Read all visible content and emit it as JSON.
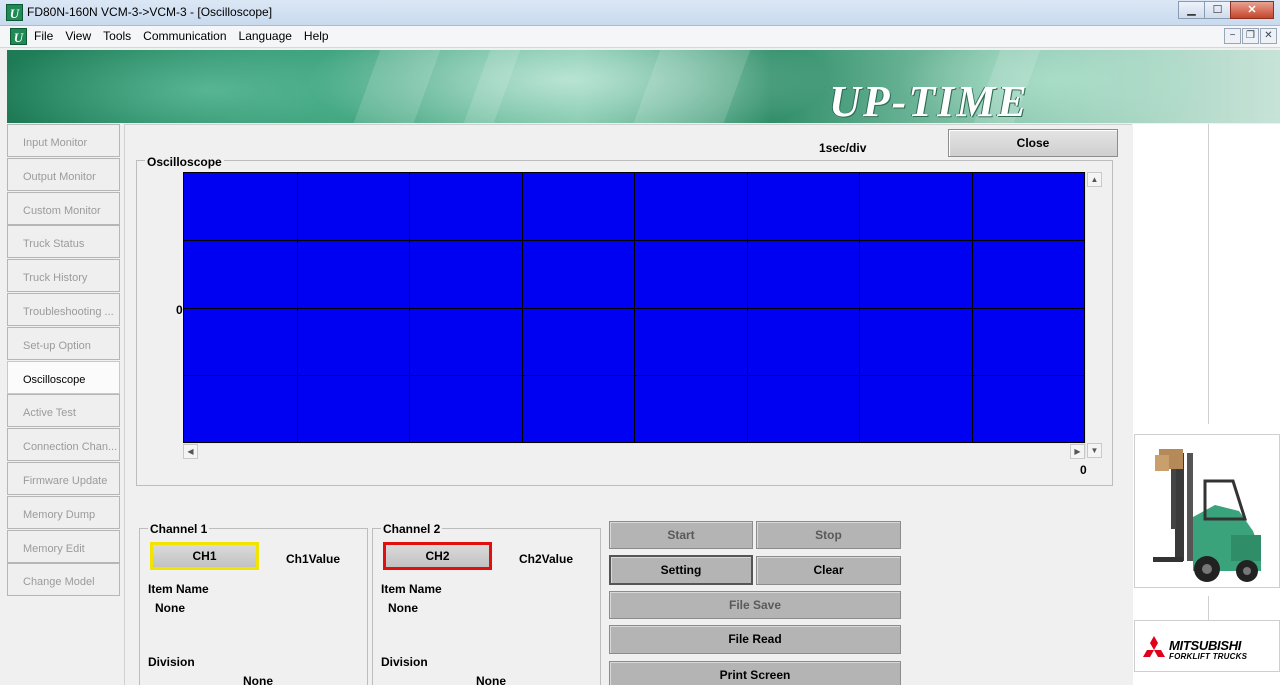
{
  "window": {
    "title": "FD80N-160N VCM-3->VCM-3 - [Oscilloscope]",
    "minimize": "▁",
    "maximize": "☐",
    "close": "✕"
  },
  "menu": {
    "items": [
      "File",
      "View",
      "Tools",
      "Communication",
      "Language",
      "Help"
    ],
    "mdi_minimize": "−",
    "mdi_restore": "❐",
    "mdi_close": "✕"
  },
  "banner": {
    "logo": "UP-TIME"
  },
  "sidebar": {
    "items": [
      {
        "label": "Input Monitor",
        "active": false
      },
      {
        "label": "Output Monitor",
        "active": false
      },
      {
        "label": "Custom Monitor",
        "active": false
      },
      {
        "label": "Truck Status",
        "active": false
      },
      {
        "label": "Truck History",
        "active": false
      },
      {
        "label": "Troubleshooting ...",
        "active": false
      },
      {
        "label": "Set-up Option",
        "active": false
      },
      {
        "label": "Oscilloscope",
        "active": true
      },
      {
        "label": "Active Test",
        "active": false
      },
      {
        "label": "Connection Chan...",
        "active": false
      },
      {
        "label": "Firmware Update",
        "active": false
      },
      {
        "label": "Memory Dump",
        "active": false
      },
      {
        "label": "Memory Edit",
        "active": false
      },
      {
        "label": "Change Model",
        "active": false
      }
    ]
  },
  "oscilloscope": {
    "scale": "1sec/div",
    "close_label": "Close",
    "group_label": "Oscilloscope",
    "y_zero": "0",
    "x_zero": "0",
    "plot_color": "#0000f2",
    "grid_color": "#000000",
    "grid_columns": 8,
    "grid_rows": 4
  },
  "channel1": {
    "legend": "Channel 1",
    "button": "CH1",
    "border_color": "#f2e400",
    "value_label": "Ch1Value",
    "item_name_label": "Item Name",
    "item_name_value": "None",
    "division_label": "Division",
    "division_value": "None"
  },
  "channel2": {
    "legend": "Channel 2",
    "button": "CH2",
    "border_color": "#e01010",
    "value_label": "Ch2Value",
    "item_name_label": "Item Name",
    "item_name_value": "None",
    "division_label": "Division",
    "division_value": "None"
  },
  "controls": {
    "start": "Start",
    "stop": "Stop",
    "setting": "Setting",
    "clear": "Clear",
    "file_save": "File Save",
    "file_read": "File Read",
    "print_screen": "Print Screen"
  },
  "brand": {
    "name": "MITSUBISHI",
    "sub": "FORKLIFT TRUCKS",
    "color": "#e0001a"
  }
}
